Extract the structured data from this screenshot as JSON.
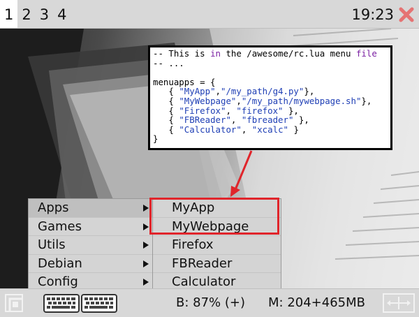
{
  "topbar": {
    "tags": [
      "1",
      "2",
      "3",
      "4"
    ],
    "active_tag": "1",
    "clock": "19:23",
    "close_icon": "close-x-icon",
    "accent_color": "#e57373"
  },
  "code": {
    "lines": [
      "-- This is in the /awesome/rc.lua menu file",
      "-- ...",
      "",
      "menuapps = {",
      "   { \"MyApp\",\"/my_path/g4.py\"},",
      "   { \"MyWebpage\",\"/my_path/mywebpage.sh\"},",
      "   { \"Firefox\", \"firefox\" },",
      "   { \"FBReader\", \"fbreader\" },",
      "   { \"Calculator\", \"xcalc\" }",
      "}"
    ]
  },
  "menu": {
    "items": [
      {
        "label": "Apps"
      },
      {
        "label": "Games"
      },
      {
        "label": "Utils"
      },
      {
        "label": "Debian"
      },
      {
        "label": "Config"
      }
    ],
    "submenu": [
      {
        "label": "MyApp"
      },
      {
        "label": "MyWebpage"
      },
      {
        "label": "Firefox"
      },
      {
        "label": "FBReader"
      },
      {
        "label": "Calculator"
      }
    ],
    "highlight_color": "#e0252b"
  },
  "bottombar": {
    "battery": "B: 87% (+)",
    "memory": "M: 204+465MB",
    "icons": [
      "launcher-icon",
      "keyboard-icon",
      "keyboard-icon",
      "resize-icon"
    ]
  }
}
